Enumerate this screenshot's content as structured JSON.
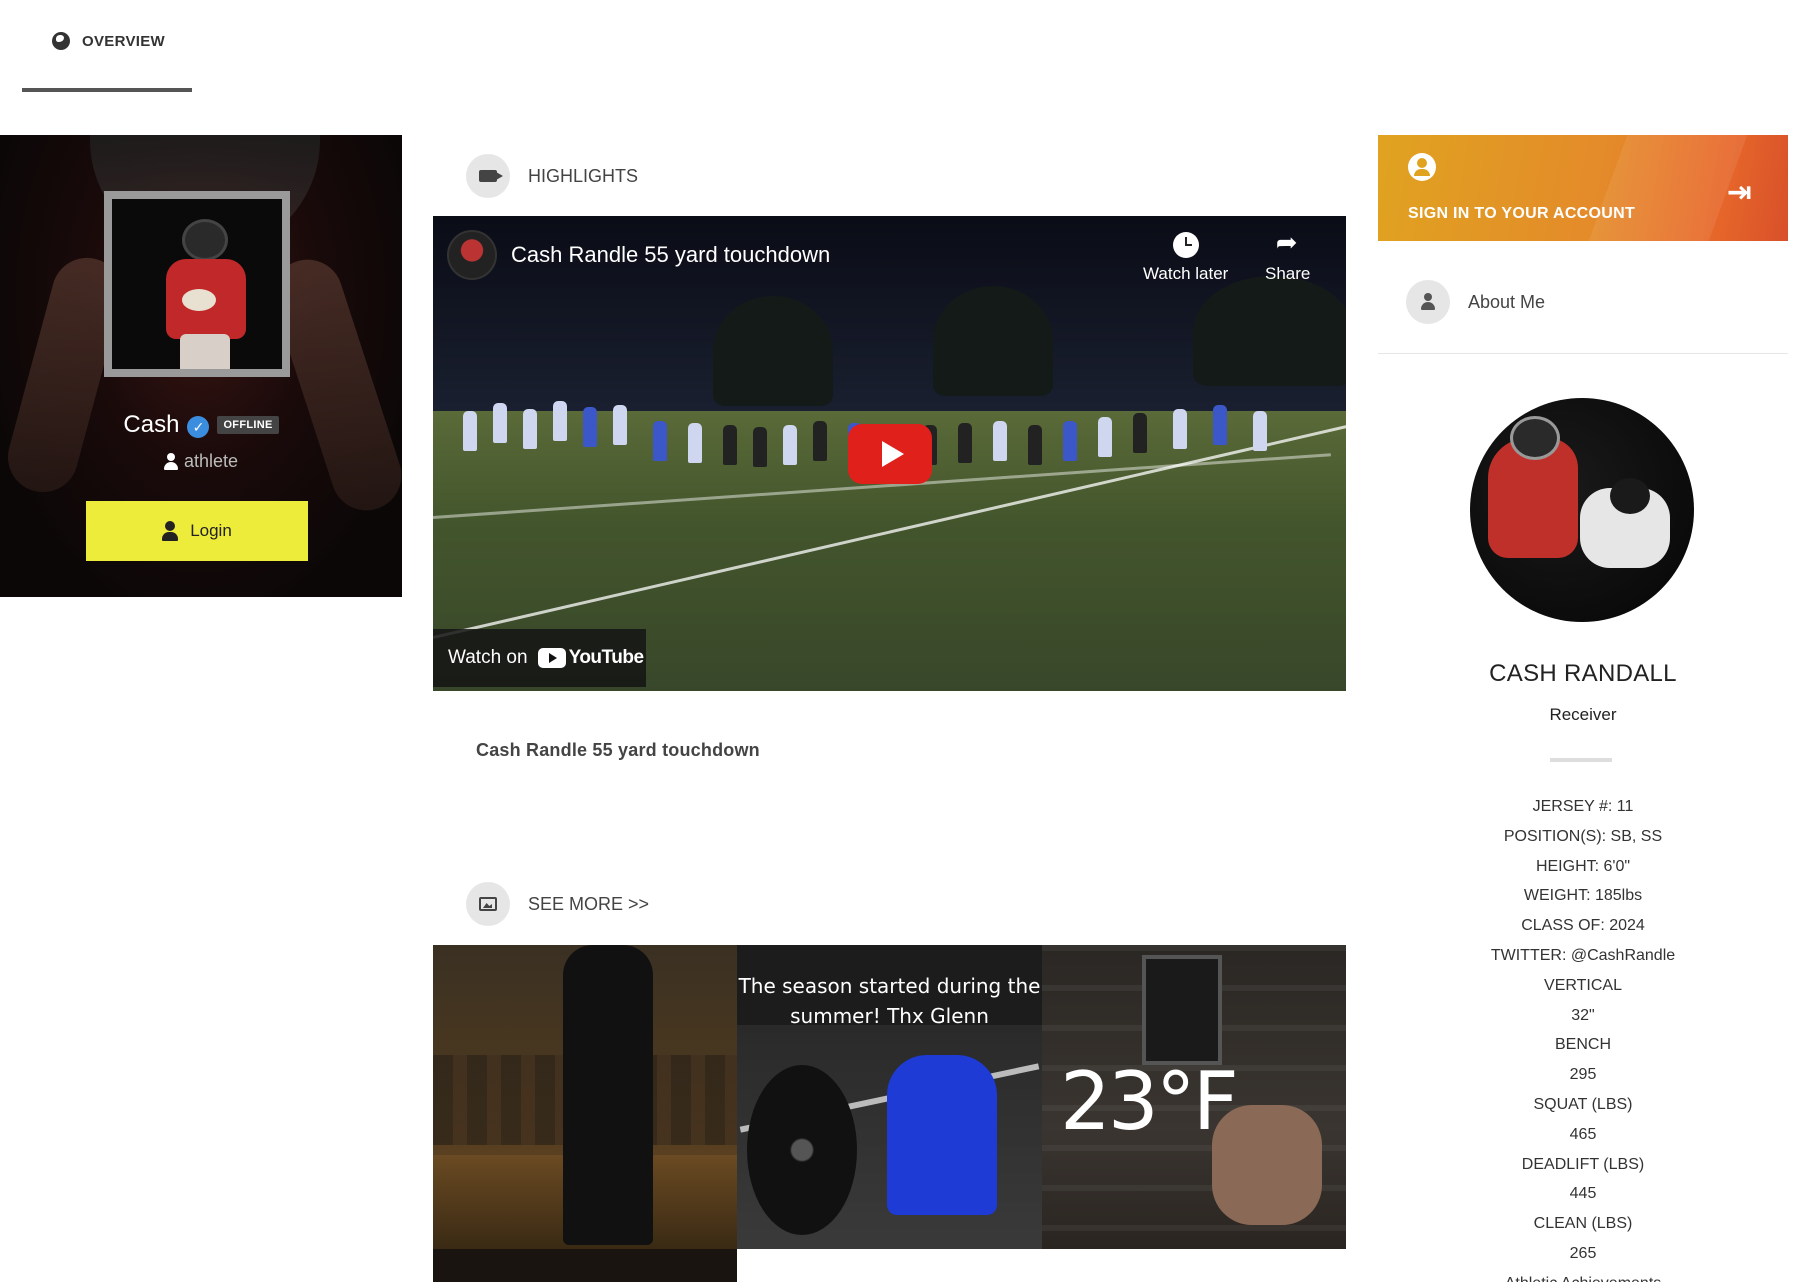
{
  "nav": {
    "tabs": [
      {
        "label": "OVERVIEW",
        "icon": "globe-icon",
        "active": true
      }
    ]
  },
  "profile_card": {
    "name": "Cash",
    "verified": true,
    "status": "OFFLINE",
    "role": "athlete",
    "login_label": "Login"
  },
  "highlights": {
    "heading": "HIGHLIGHTS",
    "video": {
      "title": "Cash Randle 55 yard touchdown",
      "watch_later": "Watch later",
      "share": "Share",
      "watch_on": "Watch on",
      "youtube": "YouTube"
    },
    "caption": "Cash Randle 55 yard touchdown"
  },
  "gallery": {
    "heading": "SEE MORE >>",
    "items": [
      {
        "overlay": ""
      },
      {
        "overlay_line1": "The season started during the",
        "overlay_line2": "summer! Thx Glenn"
      },
      {
        "overlay": "23°F"
      }
    ]
  },
  "sidebar": {
    "signin_label": "SIGN IN TO YOUR ACCOUNT",
    "about_label": "About Me",
    "full_name": "CASH RANDALL",
    "position": "Receiver",
    "stats": [
      "JERSEY #: 11",
      "POSITION(S): SB, SS",
      "HEIGHT: 6'0\"",
      "WEIGHT: 185lbs",
      "CLASS OF: 2024",
      "TWITTER: @CashRandle",
      "VERTICAL",
      "32\"",
      "BENCH",
      "295",
      "SQUAT (LBS)",
      "465",
      "DEADLIFT (LBS)",
      "445",
      "CLEAN (LBS)",
      "265",
      "Athletic Achievements"
    ]
  },
  "colors": {
    "login_button": "#eeec3a",
    "signin_gradient_start": "#e0a320",
    "signin_gradient_end": "#d8502a",
    "youtube_red": "#e0201a",
    "verified_blue": "#3b8de0"
  }
}
